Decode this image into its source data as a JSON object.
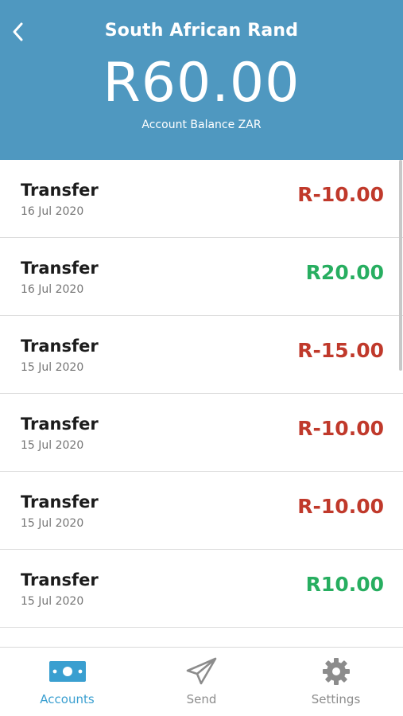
{
  "header": {
    "title": "South African Rand",
    "balance": "R60.00",
    "balance_label": "Account Balance ZAR",
    "background_color": "#4f98c0"
  },
  "transactions": [
    {
      "title": "Transfer",
      "date": "16 Jul 2020",
      "amount": "R-10.00",
      "type": "debit"
    },
    {
      "title": "Transfer",
      "date": "16 Jul 2020",
      "amount": "R20.00",
      "type": "credit"
    },
    {
      "title": "Transfer",
      "date": "15 Jul 2020",
      "amount": "R-15.00",
      "type": "debit"
    },
    {
      "title": "Transfer",
      "date": "15 Jul 2020",
      "amount": "R-10.00",
      "type": "debit"
    },
    {
      "title": "Transfer",
      "date": "15 Jul 2020",
      "amount": "R-10.00",
      "type": "debit"
    },
    {
      "title": "Transfer",
      "date": "15 Jul 2020",
      "amount": "R10.00",
      "type": "credit"
    }
  ],
  "colors": {
    "debit": "#c0392b",
    "credit": "#27ae60",
    "nav_active": "#3a9fd0",
    "nav_inactive": "#8c8c8c"
  },
  "nav": {
    "accounts_label": "Accounts",
    "send_label": "Send",
    "settings_label": "Settings",
    "active": "accounts",
    "icons": {
      "accounts": "banknote-icon",
      "send": "paper-plane-icon",
      "settings": "gear-icon"
    }
  }
}
